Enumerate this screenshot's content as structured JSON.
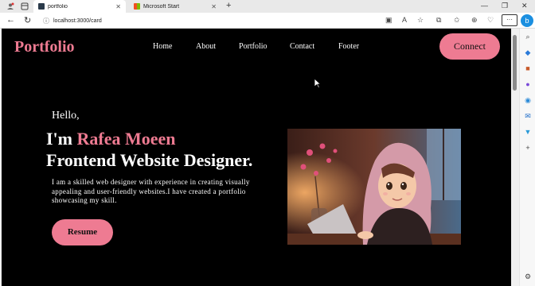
{
  "browser": {
    "tabs": [
      {
        "title": "portfolio",
        "active": true
      },
      {
        "title": "Microsoft Start",
        "active": false
      }
    ],
    "url": "localhost:3000/card",
    "icons": [
      "profile-icon",
      "workspaces-icon",
      "back-icon",
      "refresh-icon",
      "info-icon",
      "split-icon",
      "read-aloud-icon",
      "favorite-icon",
      "favorites-icon",
      "collections-icon",
      "extensions-icon",
      "more-icon",
      "copilot-icon"
    ]
  },
  "page": {
    "logo": "Portfolio",
    "nav": [
      "Home",
      "About",
      "Portfolio",
      "Contact",
      "Footer"
    ],
    "connect_label": "Connect",
    "hello": "Hello,",
    "intro_prefix": "I'm",
    "name": "Rafea Moeen",
    "role": "Frontend Website Designer.",
    "bio": "I am a skilled web designer with experience in creating visually appealing and user-friendly websites.I have created a portfolio showcasing my skill.",
    "resume_label": "Resume"
  },
  "colors": {
    "accent": "#ee7b92",
    "background": "#000000"
  }
}
